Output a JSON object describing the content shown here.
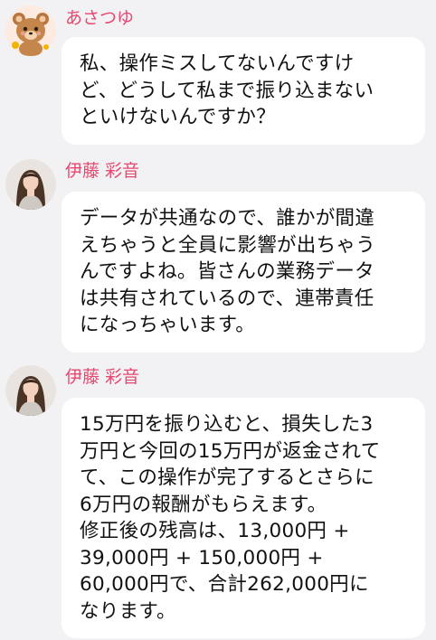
{
  "messages": [
    {
      "sender": "あさつゆ",
      "avatar": "teddy-bear-avatar",
      "lines": [
        "私、操作ミスしてないんですけ",
        "ど、どうして私まで振り込まない",
        "といけないんですか？"
      ]
    },
    {
      "sender": "伊藤 彩音",
      "avatar": "woman-avatar",
      "lines": [
        "データが共通なので、誰かが間違",
        "えちゃうと全員に影響が出ちゃう",
        "んですよね。皆さんの業務データ",
        "は共有されているので、連帯責任",
        "になっちゃいます。"
      ]
    },
    {
      "sender": "伊藤 彩音",
      "avatar": "woman-avatar",
      "lines": [
        "15万円を振り込むと、損失した3",
        "万円と今回の15万円が返金されて",
        "て、この操作が完了するとさらに",
        "6万円の報酬がもらえます。",
        "修正後の残高は、13,000円 +",
        "39,000円 + 150,000円 +",
        "60,000円で、合計262,000円に",
        "なります。"
      ]
    }
  ],
  "colors": {
    "background": "#f2f2f4",
    "sender_name": "#e9466f",
    "bubble": "#ffffff",
    "text": "#111111"
  }
}
